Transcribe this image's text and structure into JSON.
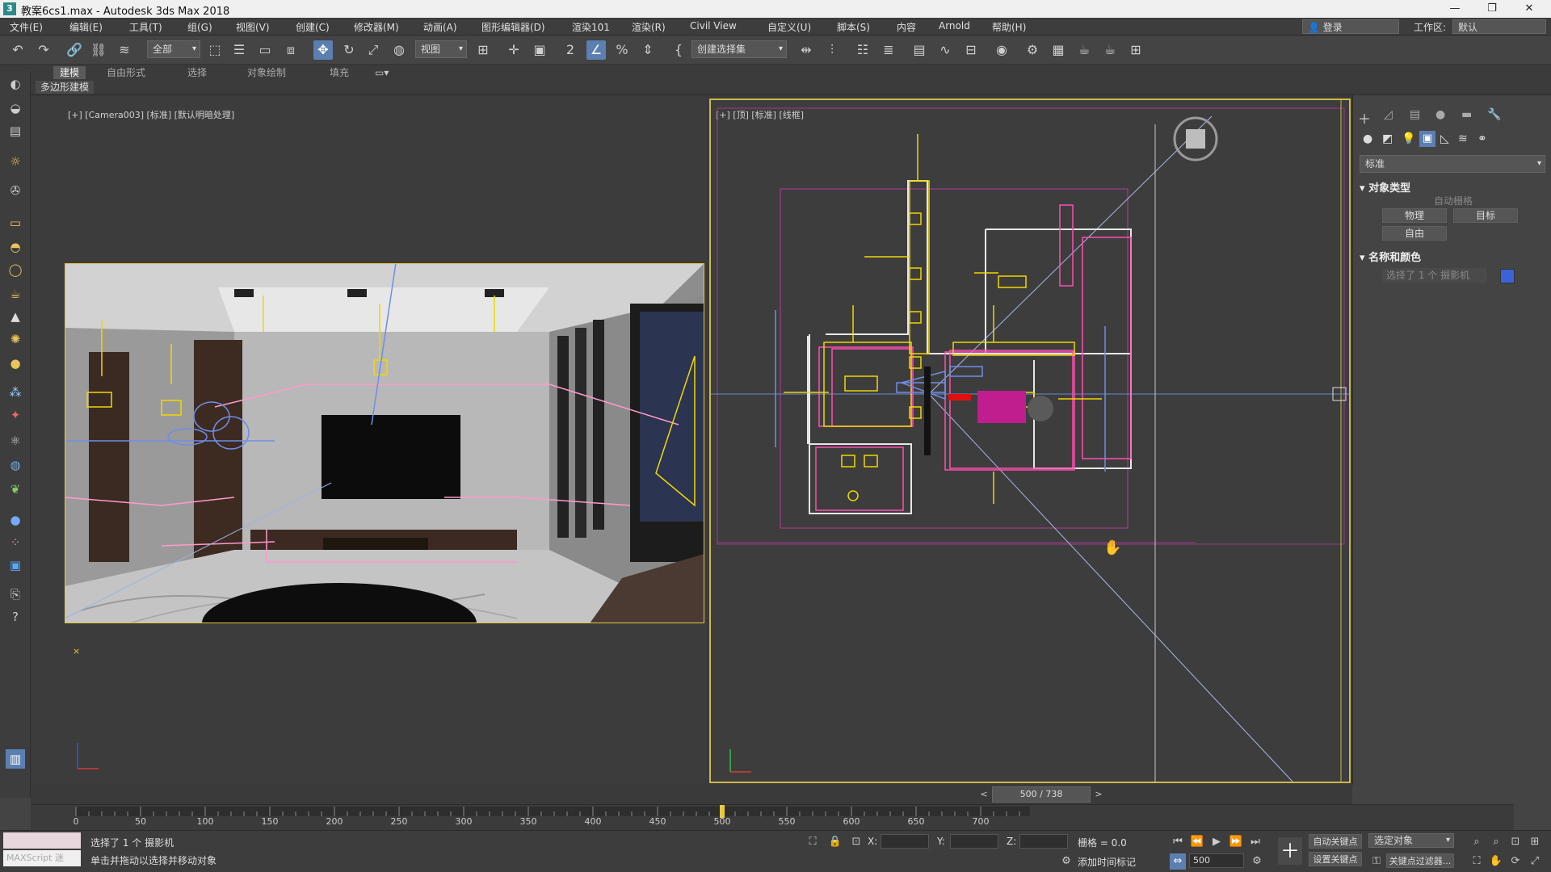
{
  "window": {
    "title": "教案6cs1.max - Autodesk 3ds Max 2018",
    "app_icon": "3",
    "min": "—",
    "max": "❐",
    "close": "✕"
  },
  "menu": {
    "items": [
      "文件(E)",
      "编辑(E)",
      "工具(T)",
      "组(G)",
      "视图(V)",
      "创建(C)",
      "修改器(M)",
      "动画(A)",
      "图形编辑器(D)",
      "渲染101",
      "渲染(R)",
      "Civil View",
      "自定义(U)",
      "脚本(S)",
      "内容",
      "Arnold",
      "帮助(H)"
    ],
    "login": "登录",
    "workspace_label": "工作区:",
    "workspace_value": "默认"
  },
  "toolbar": {
    "filter_dropdown": "全部",
    "view_dropdown": "视图",
    "selection_set_dropdown": "创建选择集"
  },
  "ribbon": {
    "tabs": [
      "建模",
      "自由形式",
      "选择",
      "对象绘制",
      "填充"
    ],
    "subtab": "多边形建模"
  },
  "viewports": {
    "camera_label": "[+] [Camera003] [标准] [默认明暗处理]",
    "top_label": "[+] [顶] [标准] [线框]"
  },
  "command_panel": {
    "category_dropdown": "标准",
    "object_type_title": "对象类型",
    "autogrid": "自动栅格",
    "buttons": [
      "物理",
      "目标",
      "自由"
    ],
    "name_color_title": "名称和颜色",
    "name_field": "选择了 1 个 摄影机",
    "object_color": "#3b63d8"
  },
  "timeslider": {
    "position": "500 / 738",
    "prev": "<",
    "next": ">"
  },
  "timeline": {
    "ticks": [
      "0",
      "50",
      "100",
      "150",
      "200",
      "250",
      "300",
      "350",
      "400",
      "450",
      "500",
      "550",
      "600",
      "650",
      "700"
    ],
    "current": 500
  },
  "status": {
    "selection": "选择了 1 个 摄影机",
    "prompt": "单击并拖动以选择并移动对象",
    "maxscript": "MAXScript 迷",
    "x_label": "X:",
    "y_label": "Y:",
    "z_label": "Z:",
    "grid": "栅格 = 0.0",
    "add_time_tag": "添加时间标记",
    "auto_key": "自动关键点",
    "set_key": "设置关键点",
    "selected_object_dropdown": "选定对象",
    "key_filters": "关键点过滤器...",
    "frame_value": "500"
  }
}
